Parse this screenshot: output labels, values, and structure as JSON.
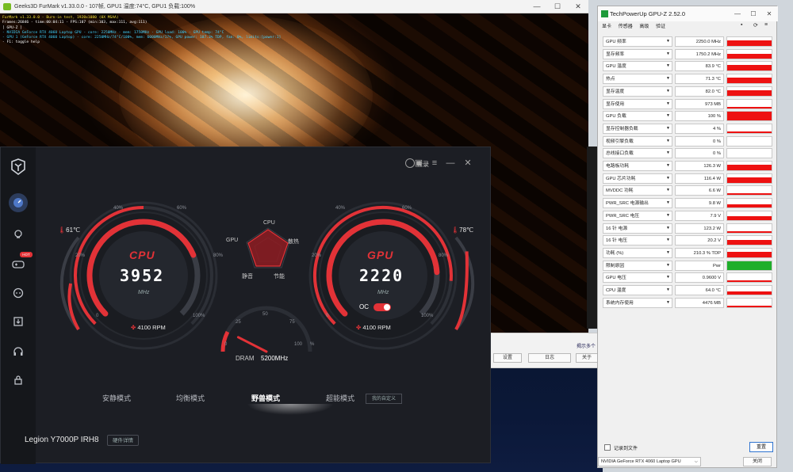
{
  "furmark": {
    "title": "Geeks3D FurMark v1.33.0.0 - 107帧, GPU1 温度:74°C, GPU1 负载:100%",
    "osd": [
      "FurMark v1.33.0.0 - Burn-in test, 1920x1080 (0X MSAA)",
      "Frames:26846 - time:00:04:11 - FPS:107 (min:103, max:111, avg:111)",
      "[ GPU-Z ]",
      "- NVIDIA GeForce RTX 4060 Laptop GPU - core: 2250MHz - mem: 1750MHz - GPU load: 100% - GPU temp: 74°C",
      "- GPU 1 (GeForce RTX 4060 Laptop) - core: 2250MHz/74°C/100%, mem: 6000MHz/17%, GPU power: 107.3% TDP, fan: 0%, limits:[power:1]",
      "- F1: toggle help"
    ]
  },
  "sub_window": {
    "link": "揭示多个",
    "buttons": [
      "设置",
      "日志",
      "关于"
    ]
  },
  "legion": {
    "login": "登录",
    "cpu": {
      "name": "CPU",
      "value": "3952",
      "unit": "MHz",
      "temp": "61℃",
      "rpm": "4100 RPM",
      "ticks": [
        "0",
        "20%",
        "40%",
        "60%",
        "80%",
        "100%"
      ],
      "load": 0.75,
      "temp_level": 0.5
    },
    "gpu": {
      "name": "GPU",
      "value": "2220",
      "unit": "MHz",
      "temp": "78℃",
      "rpm": "4100 RPM",
      "ticks": [
        "0",
        "20%",
        "40%",
        "60%",
        "80%",
        "100%"
      ],
      "load": 0.82,
      "temp_level": 0.85,
      "oc_label": "OC",
      "oc_on": true
    },
    "radar": {
      "labels": [
        "CPU",
        "散热",
        "节能",
        "静音",
        "GPU"
      ]
    },
    "dram": {
      "label": "DRAM",
      "value": "5200MHz",
      "ticks": [
        "0",
        "25",
        "50",
        "75",
        "100"
      ],
      "unit": "%",
      "level": 0.15
    },
    "modes": [
      "安静模式",
      "均衡模式",
      "野兽模式",
      "超能模式"
    ],
    "active_mode": "野兽模式",
    "custom_label": "我的自定义",
    "model": "Legion Y7000P IRH8",
    "hw_details": "硬件详情",
    "hot_badge": "HOT",
    "accent": "#e23237"
  },
  "gpuz": {
    "title": "TechPowerUp GPU-Z 2.52.0",
    "tabs": [
      "显卡",
      "传感器",
      "高级",
      "验证"
    ],
    "rows": [
      {
        "label": "GPU 频率",
        "value": "2250.0 MHz",
        "bar": 0.55
      },
      {
        "label": "显存频率",
        "value": "1750.2 MHz",
        "bar": 0.5
      },
      {
        "label": "GPU 温度",
        "value": "83.9 °C",
        "bar": 0.6
      },
      {
        "label": "热点",
        "value": "71.3 °C",
        "bar": 0.55
      },
      {
        "label": "显存温度",
        "value": "82.0 °C",
        "bar": 0.6
      },
      {
        "label": "显存使用",
        "value": "973 MB",
        "bar": 0.12
      },
      {
        "label": "GPU 负载",
        "value": "100 %",
        "bar": 1.0
      },
      {
        "label": "显存控制器负载",
        "value": "4 %",
        "bar": 0.06
      },
      {
        "label": "视频引擎负载",
        "value": "0 %",
        "bar": 0.0
      },
      {
        "label": "总线接口负载",
        "value": "0 %",
        "bar": 0.0
      },
      {
        "label": "电路板功耗",
        "value": "126.3 W",
        "bar": 0.6
      },
      {
        "label": "GPU 芯片功耗",
        "value": "116.4 W",
        "bar": 0.55
      },
      {
        "label": "MVDDC 功耗",
        "value": "6.6 W",
        "bar": 0.12
      },
      {
        "label": "PWR_SRC 电源输出",
        "value": "9.8 W",
        "bar": 0.35
      },
      {
        "label": "PWR_SRC 电压",
        "value": "7.9 V",
        "bar": 0.4
      },
      {
        "label": "16 针 电源",
        "value": "123.2 W",
        "bar": 0.15
      },
      {
        "label": "16 针 电压",
        "value": "20.2 V",
        "bar": 0.5
      },
      {
        "label": "功耗 (%)",
        "value": "210.3 % TDP",
        "bar": 0.6
      },
      {
        "label": "限制原因",
        "value": "Pwr",
        "bar": 1.0,
        "color": "#1fae2a"
      },
      {
        "label": "GPU 电压",
        "value": "0.9600 V",
        "bar": 0.2
      },
      {
        "label": "CPU 温度",
        "value": "64.0 °C",
        "bar": 0.3
      },
      {
        "label": "系统内存使用",
        "value": "4476 MB",
        "bar": 0.15
      }
    ],
    "log_label": "记录到文件",
    "reset": "重置",
    "gpu_select": "NVIDIA GeForce RTX 4060 Laptop GPU",
    "close": "关闭"
  }
}
